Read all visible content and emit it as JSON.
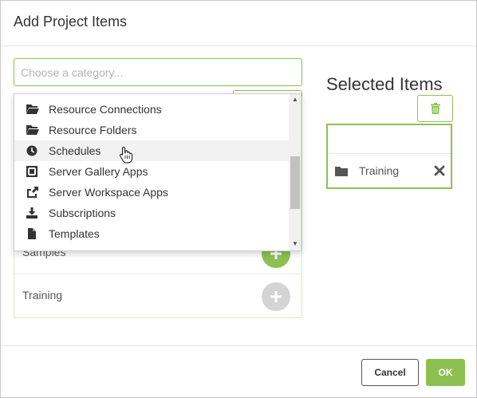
{
  "dialog": {
    "title": "Add Project Items"
  },
  "category_input": {
    "placeholder": "Choose a category..."
  },
  "dropdown": {
    "items": [
      {
        "label": "Resource Connections",
        "icon": "folder-open-icon"
      },
      {
        "label": "Resource Folders",
        "icon": "folder-open-icon"
      },
      {
        "label": "Schedules",
        "icon": "clock-icon",
        "hovered": true
      },
      {
        "label": "Server Gallery Apps",
        "icon": "gallery-icon"
      },
      {
        "label": "Server Workspace Apps",
        "icon": "share-icon"
      },
      {
        "label": "Subscriptions",
        "icon": "download-icon"
      },
      {
        "label": "Templates",
        "icon": "file-icon"
      }
    ]
  },
  "list": {
    "rows": [
      {
        "label": "Samples",
        "add_state": "active"
      },
      {
        "label": "Training",
        "add_state": "disabled"
      }
    ]
  },
  "selected": {
    "title": "Selected Items",
    "items": [
      {
        "label": "Training"
      }
    ]
  },
  "footer": {
    "cancel_label": "Cancel",
    "ok_label": "OK"
  },
  "colors": {
    "accent": "#8cc152",
    "disabled": "#d4d4d4"
  }
}
